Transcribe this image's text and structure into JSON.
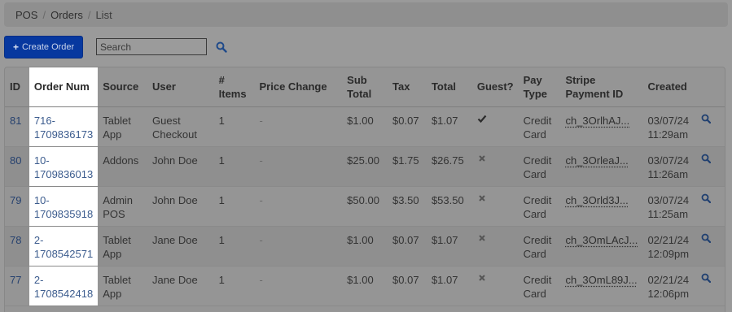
{
  "breadcrumb": [
    {
      "label": "POS"
    },
    {
      "label": "Orders"
    },
    {
      "label": "List"
    }
  ],
  "toolbar": {
    "create_label": "Create Order",
    "search_placeholder": "Search"
  },
  "table": {
    "headers": {
      "id": "ID",
      "order": "Order Num",
      "source": "Source",
      "user": "User",
      "items": "# Items",
      "price_change": "Price Change",
      "subtotal": "Sub Total",
      "tax": "Tax",
      "total": "Total",
      "guest": "Guest?",
      "pay_type": "Pay Type",
      "stripe": "Stripe Payment ID",
      "created": "Created"
    },
    "rows": [
      {
        "id": "81",
        "order": "716-1709836173",
        "source": "Tablet App",
        "user": "Guest Checkout",
        "items": "1",
        "price_change": "-",
        "subtotal": "$1.00",
        "tax": "$0.07",
        "total": "$1.07",
        "guest": "check",
        "pay_type": "Credit Card",
        "stripe": "ch_3OrlhAJ...",
        "created": "03/07/24 11:29am"
      },
      {
        "id": "80",
        "order": "10-1709836013",
        "source": "Addons",
        "user": "John Doe",
        "items": "1",
        "price_change": "-",
        "subtotal": "$25.00",
        "tax": "$1.75",
        "total": "$26.75",
        "guest": "times",
        "pay_type": "Credit Card",
        "stripe": "ch_3OrleaJ...",
        "created": "03/07/24 11:26am"
      },
      {
        "id": "79",
        "order": "10-1709835918",
        "source": "Admin POS",
        "user": "John Doe",
        "items": "1",
        "price_change": "-",
        "subtotal": "$50.00",
        "tax": "$3.50",
        "total": "$53.50",
        "guest": "times",
        "pay_type": "Credit Card",
        "stripe": "ch_3Orld3J...",
        "created": "03/07/24 11:25am"
      },
      {
        "id": "78",
        "order": "2-1708542571",
        "source": "Tablet App",
        "user": "Jane Doe",
        "items": "1",
        "price_change": "-",
        "subtotal": "$1.00",
        "tax": "$0.07",
        "total": "$1.07",
        "guest": "times",
        "pay_type": "Credit Card",
        "stripe": "ch_3OmLAcJ...",
        "created": "02/21/24 12:09pm"
      },
      {
        "id": "77",
        "order": "2-1708542418",
        "source": "Tablet App",
        "user": "Jane Doe",
        "items": "1",
        "price_change": "-",
        "subtotal": "$1.00",
        "tax": "$0.07",
        "total": "$1.07",
        "guest": "times",
        "pay_type": "Credit Card",
        "stripe": "ch_3OmL89J...",
        "created": "02/21/24 12:06pm"
      }
    ]
  },
  "icons": {
    "plus": "plus-icon",
    "search": "search-icon",
    "check": "check-icon",
    "times": "times-icon",
    "view": "magnifier-icon"
  },
  "colors": {
    "primary_button": "#07389f",
    "link": "#3c5c8e",
    "search_icon": "#1f4a8a"
  }
}
